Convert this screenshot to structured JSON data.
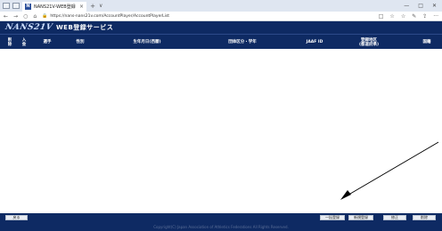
{
  "browser": {
    "tab_title": "NANS21V-WEB登録",
    "tab_favicon": "N",
    "tab_close": "×",
    "new_tab": "+",
    "tab_menu": "∨",
    "window_min": "—",
    "window_max": "□",
    "window_close": "✕",
    "nav_back": "←",
    "nav_forward": "→",
    "nav_reload": "○",
    "nav_home": "⌂",
    "lock": "🔒",
    "url": "https://nans-nans21v.com/AccountPlayer/AccountPlayerList",
    "icons": {
      "reading": "□",
      "favorite": "☆",
      "favorites_bar": "☆",
      "pen": "✎",
      "share": "⇪",
      "more": "···"
    }
  },
  "header": {
    "logo": "NANS21V",
    "service_title": "WEB登録サービス"
  },
  "table": {
    "columns": [
      "削\n除",
      "入\n金",
      "選手",
      "性別",
      "生年月日(西暦)",
      "団体区分・学年",
      "JAAF ID",
      "登録地区\n(都道府県)",
      "国籍"
    ]
  },
  "footer": {
    "back_button": "戻る",
    "bulk_register_button": "一括登録",
    "new_register_button": "新規登録",
    "edit_button": "修正",
    "delete_button": "削除",
    "copyright": "Copyright(C) Japan Association of Athletics Federations All Rights Reserved."
  }
}
